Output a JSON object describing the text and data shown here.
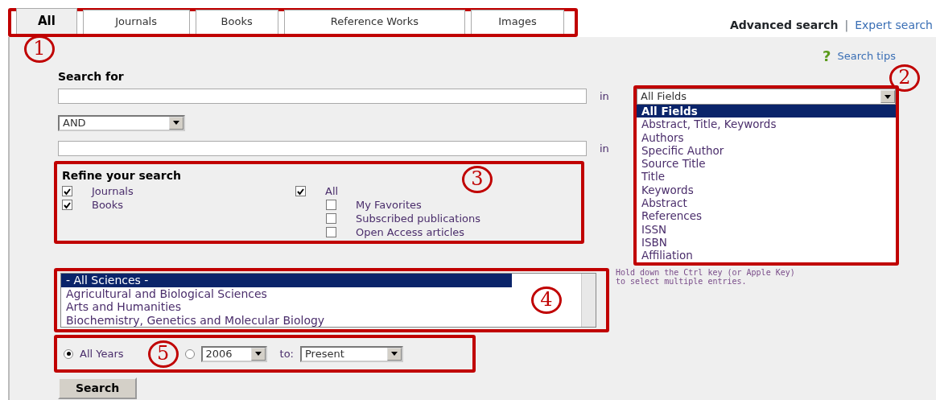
{
  "tabs": {
    "callout": "1",
    "items": [
      {
        "label": "All",
        "selected": true
      },
      {
        "label": "Journals",
        "selected": false
      },
      {
        "label": "Books",
        "selected": false
      },
      {
        "label": "Reference Works",
        "selected": false
      },
      {
        "label": "Images",
        "selected": false
      }
    ]
  },
  "header_links": {
    "advanced": "Advanced search",
    "separator": "|",
    "expert": "Expert search"
  },
  "search_tips": {
    "icon": "?",
    "label": "Search tips"
  },
  "search_for": {
    "label": "Search for",
    "in_label_1": "in",
    "operator": "AND",
    "in_label_2": "in"
  },
  "field_dropdown": {
    "callout": "2",
    "value": "All Fields",
    "options": [
      {
        "label": "All Fields",
        "selected": true
      },
      {
        "label": "Abstract, Title, Keywords",
        "selected": false
      },
      {
        "label": "Authors",
        "selected": false
      },
      {
        "label": "Specific Author",
        "selected": false
      },
      {
        "label": "Source Title",
        "selected": false
      },
      {
        "label": "Title",
        "selected": false
      },
      {
        "label": "Keywords",
        "selected": false
      },
      {
        "label": "Abstract",
        "selected": false
      },
      {
        "label": "References",
        "selected": false
      },
      {
        "label": "ISSN",
        "selected": false
      },
      {
        "label": "ISBN",
        "selected": false
      },
      {
        "label": "Affiliation",
        "selected": false
      }
    ]
  },
  "refine": {
    "callout": "3",
    "title": "Refine your search",
    "content_types": [
      {
        "label": "Journals",
        "checked": true
      },
      {
        "label": "Books",
        "checked": true
      }
    ],
    "sources": [
      {
        "label": "All",
        "checked": true,
        "children": [
          {
            "label": "My Favorites",
            "checked": false
          },
          {
            "label": "Subscribed publications",
            "checked": false
          },
          {
            "label": "Open Access articles",
            "checked": false
          }
        ]
      }
    ]
  },
  "subjects": {
    "callout": "4",
    "options": [
      {
        "label": "- All Sciences -",
        "selected": true
      },
      {
        "label": "Agricultural and Biological Sciences",
        "selected": false
      },
      {
        "label": "Arts and Humanities",
        "selected": false
      },
      {
        "label": "Biochemistry, Genetics and Molecular Biology",
        "selected": false
      }
    ],
    "hint": "Hold down the Ctrl key (or Apple Key)\nto select multiple entries."
  },
  "years": {
    "callout": "5",
    "all_label": "All Years",
    "all_selected": true,
    "range_selected": false,
    "from": "2006",
    "to_label": "to:",
    "to": "Present"
  },
  "search_button": "Search"
}
